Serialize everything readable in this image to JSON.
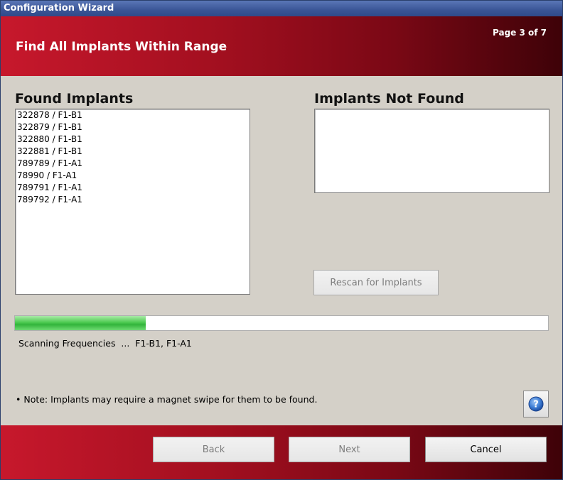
{
  "window": {
    "title": "Configuration Wizard"
  },
  "header": {
    "title": "Find All Implants Within Range",
    "page_indicator": "Page 3 of 7"
  },
  "found": {
    "label": "Found Implants",
    "items": [
      "322878 / F1-B1",
      "322879 / F1-B1",
      "322880 / F1-B1",
      "322881 / F1-B1",
      "789789 / F1-A1",
      "78990 / F1-A1",
      "789791 / F1-A1",
      "789792 / F1-A1"
    ]
  },
  "not_found": {
    "label": "Implants Not Found",
    "items": []
  },
  "rescan": {
    "label": "Rescan for Implants"
  },
  "progress": {
    "fraction": 0.245,
    "status_text": "Scanning Frequencies  ...  F1-B1, F1-A1"
  },
  "note": "• Note: Implants may require a magnet swipe for them to be found.",
  "help": {
    "icon": "help-icon"
  },
  "footer": {
    "back_label": "Back",
    "next_label": "Next",
    "cancel_label": "Cancel"
  },
  "colors": {
    "header_red": "#c7182c",
    "titlebar_blue": "#3a5596",
    "progress_green": "#3cbf44"
  }
}
